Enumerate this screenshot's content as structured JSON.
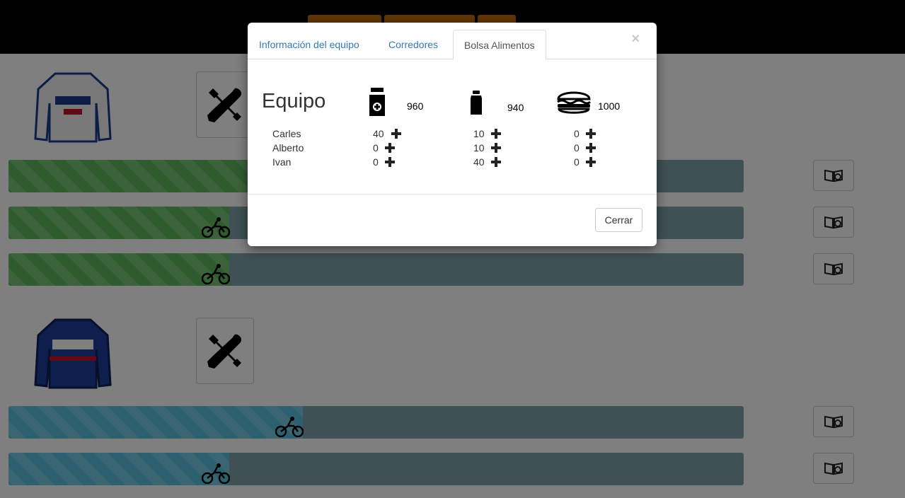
{
  "modal": {
    "tabs": [
      {
        "label": "Información del equipo",
        "active": false
      },
      {
        "label": "Corredores",
        "active": false
      },
      {
        "label": "Bolsa Alimentos",
        "active": true
      }
    ],
    "close_symbol": "×",
    "team_label": "Equipo",
    "resources": [
      {
        "icon": "medicine-bottle-icon",
        "total": "960"
      },
      {
        "icon": "water-bottle-icon",
        "total": "940"
      },
      {
        "icon": "burger-icon",
        "total": "1000"
      }
    ],
    "riders": [
      {
        "name": "Carles",
        "values": [
          "40",
          "10",
          "0"
        ]
      },
      {
        "name": "Alberto",
        "values": [
          "0",
          "10",
          "0"
        ]
      },
      {
        "name": "Ivan",
        "values": [
          "0",
          "40",
          "0"
        ]
      }
    ],
    "close_button": "Cerrar"
  },
  "background": {
    "teams": [
      {
        "jersey": "fdj-jersey",
        "color": "#5cb85c",
        "progress": [
          0.33,
          0.3,
          0.3
        ]
      },
      {
        "jersey": "quick-step-jersey",
        "color": "#5bc0de",
        "progress": [
          0.4,
          0.3
        ]
      }
    ]
  },
  "colors": {
    "accent": "#337ab7",
    "green": "#5cb85c",
    "blue": "#5bc0de",
    "track": "#7ea3a8"
  }
}
